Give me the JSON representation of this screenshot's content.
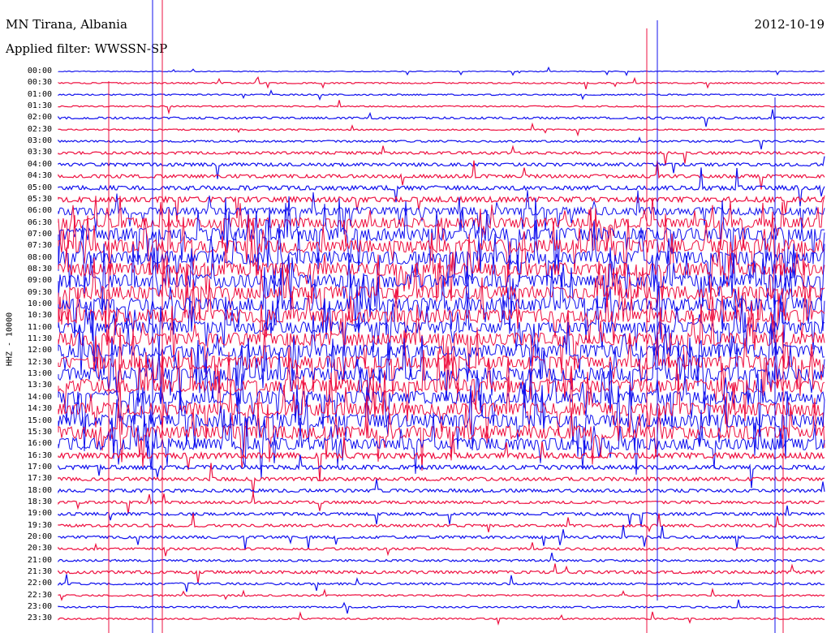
{
  "header": {
    "station": "MN Tirana, Albania",
    "filter": "Applied filter: WWSSN-SP",
    "date": "2012-10-19"
  },
  "chart_data": {
    "type": "line",
    "title": "MN Tirana, Albania",
    "subtitle": "Applied filter: WWSSN-SP",
    "date": "2012-10-19",
    "ylabel": "HHZ - 10000",
    "row_labels": [
      "00:00",
      "00:30",
      "01:00",
      "01:30",
      "02:00",
      "02:30",
      "03:00",
      "03:30",
      "04:00",
      "04:30",
      "05:00",
      "05:30",
      "06:00",
      "06:30",
      "07:00",
      "07:30",
      "08:00",
      "08:30",
      "09:00",
      "09:30",
      "10:00",
      "10:30",
      "11:00",
      "11:30",
      "12:00",
      "12:30",
      "13:00",
      "13:30",
      "14:00",
      "14:30",
      "15:00",
      "15:30",
      "16:00",
      "16:30",
      "17:00",
      "17:30",
      "18:00",
      "18:30",
      "19:00",
      "19:30",
      "20:00",
      "20:30",
      "21:00",
      "21:30",
      "22:00",
      "22:30",
      "23:00",
      "23:30"
    ],
    "row_colors": [
      "#1010ee",
      "#ee1040"
    ],
    "row_activity": [
      0.3,
      0.5,
      0.5,
      0.5,
      0.8,
      0.5,
      0.7,
      1.0,
      1.2,
      1.3,
      1.6,
      2.0,
      3.0,
      4.0,
      5.0,
      5.0,
      5.0,
      5.0,
      5.0,
      5.0,
      5.0,
      5.0,
      4.5,
      5.0,
      5.0,
      5.0,
      5.0,
      5.0,
      5.0,
      5.0,
      5.0,
      5.0,
      4.5,
      2.2,
      1.6,
      1.3,
      1.2,
      1.0,
      1.1,
      1.0,
      1.0,
      0.9,
      0.8,
      1.1,
      0.8,
      0.6,
      0.6,
      0.6
    ],
    "grid": false
  }
}
